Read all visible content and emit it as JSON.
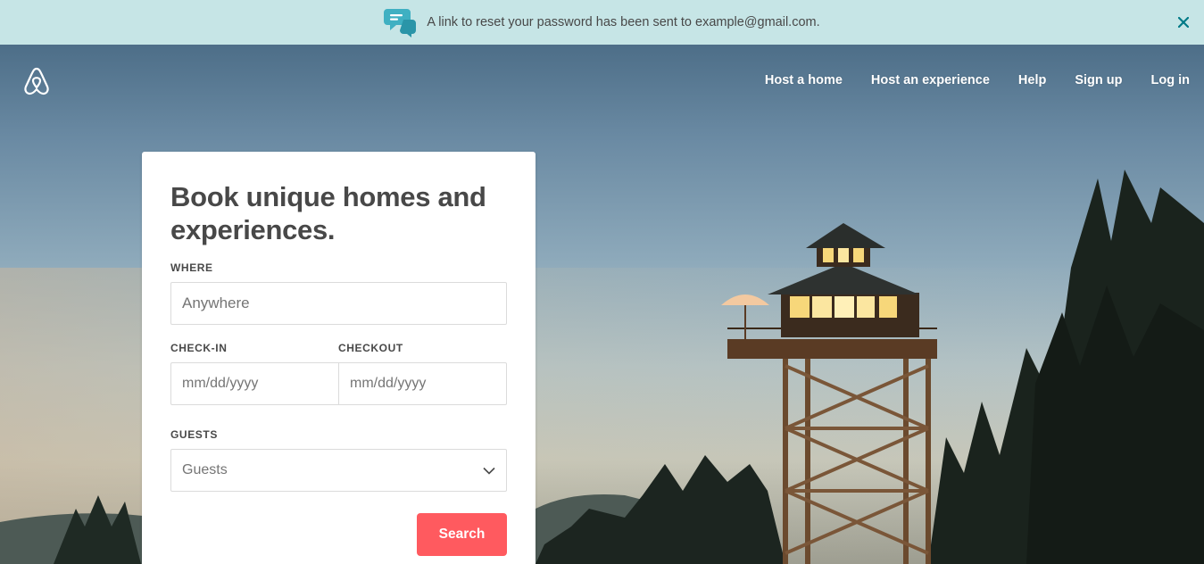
{
  "banner": {
    "message": "A link to reset your password has been sent to example@gmail.com.",
    "icon": "chat-bubbles-icon",
    "close_icon": "close-icon",
    "background": "#c6e5e6"
  },
  "header": {
    "logo": "airbnb-logo",
    "nav": {
      "host_home": "Host a home",
      "host_experience": "Host an experience",
      "help": "Help",
      "sign_up": "Sign up",
      "log_in": "Log in"
    }
  },
  "search_card": {
    "title": "Book unique homes and experiences.",
    "where": {
      "label": "WHERE",
      "placeholder": "Anywhere"
    },
    "check_in": {
      "label": "CHECK-IN",
      "placeholder": "mm/dd/yyyy"
    },
    "checkout": {
      "label": "CHECKOUT",
      "placeholder": "mm/dd/yyyy"
    },
    "guests": {
      "label": "GUESTS",
      "value": "Guests",
      "icon": "chevron-down-icon"
    },
    "search_button": "Search",
    "accent_color": "#ff5a5f"
  }
}
